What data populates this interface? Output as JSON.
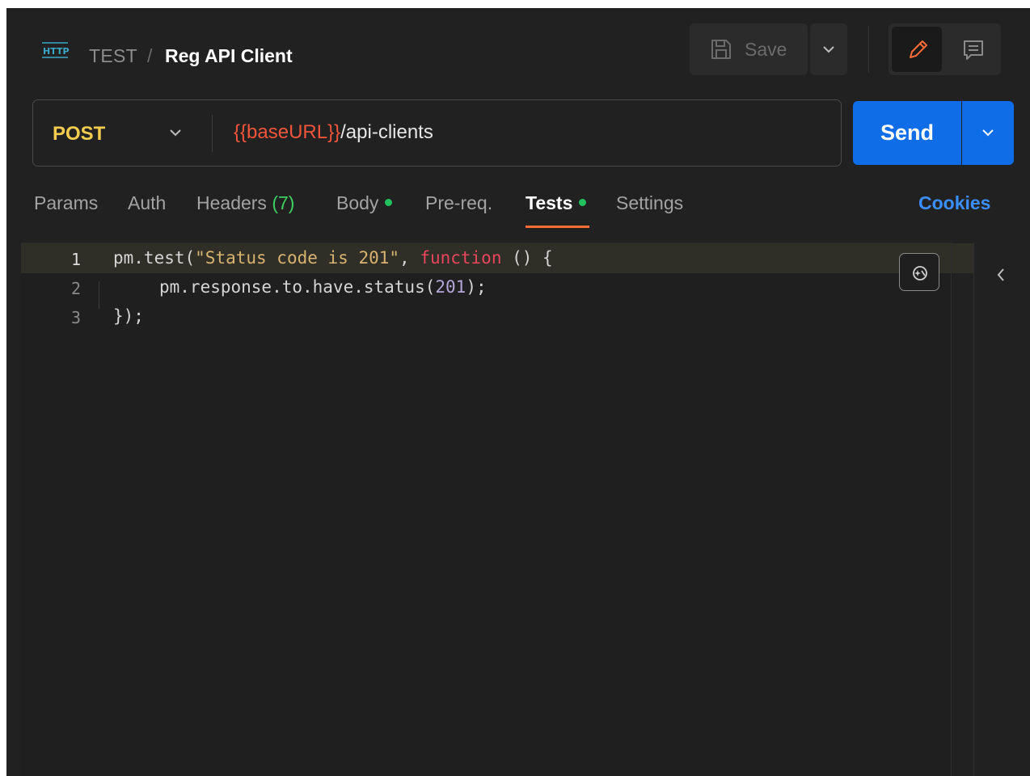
{
  "header": {
    "protocol_icon": "http-icon",
    "parent": "TEST",
    "separator": "/",
    "title": "Reg API Client",
    "save_label": "Save"
  },
  "request": {
    "method": "POST",
    "url_variable": "{{baseURL}}",
    "url_path": "/api-clients",
    "send_label": "Send"
  },
  "tabs": {
    "params": "Params",
    "auth": "Auth",
    "headers": "Headers",
    "headers_count": "(7)",
    "body": "Body",
    "prereq": "Pre-req.",
    "tests": "Tests",
    "settings": "Settings",
    "cookies": "Cookies",
    "active": "Tests"
  },
  "editor": {
    "line_numbers": [
      "1",
      "2",
      "3"
    ],
    "line1_a": "pm.test(",
    "line1_str": "\"Status code is 201\"",
    "line1_b": ", ",
    "line1_kw": "function",
    "line1_c": " () {",
    "line2_a": "pm.response.to.have.status(",
    "line2_num": "201",
    "line2_b": ");",
    "line3": "});"
  },
  "colors": {
    "accent_orange": "#ff6c37",
    "send_blue": "#0f6de8",
    "method_yellow": "#f2cc4e",
    "variable_red": "#f0553b",
    "status_green": "#21c25e",
    "link_blue": "#3b8eff"
  }
}
